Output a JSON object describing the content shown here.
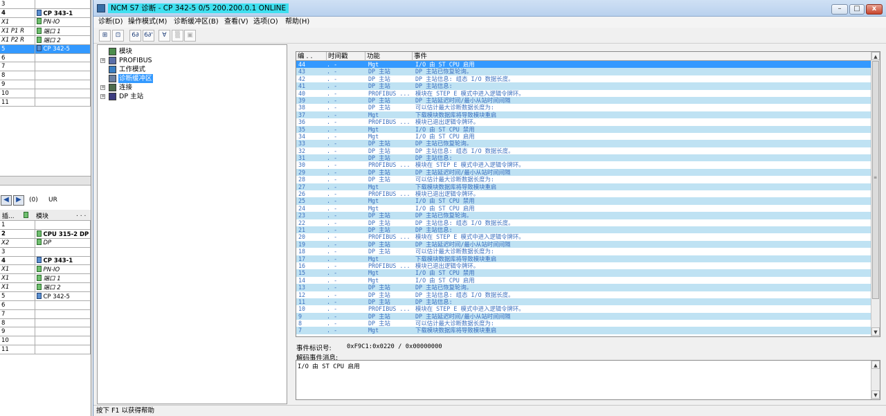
{
  "hwconfig": {
    "rack_top_rows": [
      {
        "slot": "3",
        "module": "",
        "style": "",
        "icon": ""
      },
      {
        "slot": "4",
        "module": "CP 343-1",
        "style": "bold",
        "icon": "cp"
      },
      {
        "slot": "X1",
        "module": "PN-IO",
        "style": "ital",
        "icon": "mod"
      },
      {
        "slot": "X1 P1 R",
        "module": "端口 1",
        "style": "ital",
        "icon": "mod"
      },
      {
        "slot": "X1 P2 R",
        "module": "端口 2",
        "style": "ital",
        "icon": "mod"
      },
      {
        "slot": "5",
        "module": "CP 342-5",
        "style": "sel",
        "icon": "cp"
      },
      {
        "slot": "6",
        "module": "",
        "style": "",
        "icon": ""
      },
      {
        "slot": "7",
        "module": "",
        "style": "",
        "icon": ""
      },
      {
        "slot": "8",
        "module": "",
        "style": "",
        "icon": ""
      },
      {
        "slot": "9",
        "module": "",
        "style": "",
        "icon": ""
      },
      {
        "slot": "10",
        "module": "",
        "style": "",
        "icon": ""
      },
      {
        "slot": "11",
        "module": "",
        "style": "",
        "icon": ""
      }
    ],
    "nav_rack_id": "(0)",
    "nav_rack_name": "UR",
    "slot_header_col1": "插...",
    "slot_header_col2": "模块",
    "slot_header_col3": ". . .",
    "rack_bottom_rows": [
      {
        "slot": "1",
        "module": "",
        "style": "",
        "icon": ""
      },
      {
        "slot": "2",
        "module": "CPU 315-2 DP",
        "style": "bold",
        "icon": "mod"
      },
      {
        "slot": "X2",
        "module": "DP",
        "style": "ital",
        "icon": "mod"
      },
      {
        "slot": "3",
        "module": "",
        "style": "",
        "icon": ""
      },
      {
        "slot": "4",
        "module": "CP 343-1",
        "style": "bold",
        "icon": "cp"
      },
      {
        "slot": "X1",
        "module": "PN-IO",
        "style": "ital",
        "icon": "mod"
      },
      {
        "slot": "X1",
        "module": "端口 1",
        "style": "ital",
        "icon": "mod"
      },
      {
        "slot": "X1",
        "module": "端口 2",
        "style": "ital",
        "icon": "mod"
      },
      {
        "slot": "5",
        "module": "CP 342-5",
        "style": "",
        "icon": "cp"
      },
      {
        "slot": "6",
        "module": "",
        "style": "",
        "icon": ""
      },
      {
        "slot": "7",
        "module": "",
        "style": "",
        "icon": ""
      },
      {
        "slot": "8",
        "module": "",
        "style": "",
        "icon": ""
      },
      {
        "slot": "9",
        "module": "",
        "style": "",
        "icon": ""
      },
      {
        "slot": "10",
        "module": "",
        "style": "",
        "icon": ""
      },
      {
        "slot": "11",
        "module": "",
        "style": "",
        "icon": ""
      }
    ]
  },
  "window": {
    "title": "NCM S7 诊断 - CP 342-5 0/5 200.200.0.1  ONLINE",
    "minimize": "–",
    "maximize": "□",
    "close": "x"
  },
  "menu": [
    {
      "label": "诊断(D)",
      "name": "menu-diagnose"
    },
    {
      "label": "操作模式(M)",
      "name": "menu-operating-mode"
    },
    {
      "label": "诊断缓冲区(B)",
      "name": "menu-diag-buffer"
    },
    {
      "label": "查看(V)",
      "name": "menu-view"
    },
    {
      "label": "选项(O)",
      "name": "menu-options"
    },
    {
      "label": "帮助(H)",
      "name": "menu-help"
    }
  ],
  "toolbar": [
    {
      "glyph": "⊞",
      "name": "station-button",
      "disabled": false
    },
    {
      "glyph": "⊡",
      "name": "module-button",
      "disabled": false
    },
    {
      "glyph": "6∂",
      "name": "online-button",
      "disabled": false
    },
    {
      "glyph": "6∂'",
      "name": "offline-button",
      "disabled": false
    },
    {
      "glyph": "∀",
      "name": "filter-button",
      "disabled": false
    },
    {
      "glyph": "▒",
      "name": "refresh-button",
      "disabled": true
    },
    {
      "glyph": "▣",
      "name": "print-button",
      "disabled": true
    }
  ],
  "tree": [
    {
      "label": "模块",
      "expander": "",
      "icon": "module",
      "selected": false
    },
    {
      "label": "PROFIBUS",
      "expander": "+",
      "icon": "network",
      "selected": false
    },
    {
      "label": "工作模式",
      "expander": "",
      "icon": "mode",
      "selected": false
    },
    {
      "label": "诊断缓冲区",
      "expander": "",
      "icon": "buffer",
      "selected": true
    },
    {
      "label": "连接",
      "expander": "+",
      "icon": "connection",
      "selected": false
    },
    {
      "label": "DP 主站",
      "expander": "+",
      "icon": "dp",
      "selected": false
    }
  ],
  "event_list": {
    "columns": [
      "编 . .",
      "时间戳",
      "功能",
      "事件"
    ],
    "rows": [
      [
        "44",
        ". -",
        "Mgt",
        "I/O 由 ST CPU 启用"
      ],
      [
        "43",
        ". -",
        "DP 主站",
        "DP 主站已恢复轮询。"
      ],
      [
        "42",
        ". -",
        "DP 主站",
        "DP 主站信息: 组态 I/O 数据长度。"
      ],
      [
        "41",
        ". -",
        "DP 主站",
        "DP 主站信息:"
      ],
      [
        "40",
        ". -",
        "PROFIBUS ...",
        "模块在 STEP E 模式中进入逻辑令牌环。"
      ],
      [
        "39",
        ". -",
        "DP 主站",
        "DP 主站延迟时间/最小从站时间间隔"
      ],
      [
        "38",
        ". -",
        "DP 主站",
        "可以估计最大诊断数据长度为:"
      ],
      [
        "37",
        ". -",
        "Mgt",
        "下载模块数据库将导致模块重启"
      ],
      [
        "36",
        ". -",
        "PROFIBUS ...",
        "模块已退出逻辑令牌环。"
      ],
      [
        "35",
        ". -",
        "Mgt",
        "I/O 由 ST CPU 禁用"
      ],
      [
        "34",
        ". -",
        "Mgt",
        "I/O 由 ST CPU 启用"
      ],
      [
        "33",
        ". -",
        "DP 主站",
        "DP 主站已恢复轮询。"
      ],
      [
        "32",
        ". -",
        "DP 主站",
        "DP 主站信息: 组态 I/O 数据长度。"
      ],
      [
        "31",
        ". -",
        "DP 主站",
        "DP 主站信息:"
      ],
      [
        "30",
        ". -",
        "PROFIBUS ...",
        "模块在 STEP E 模式中进入逻辑令牌环。"
      ],
      [
        "29",
        ". -",
        "DP 主站",
        "DP 主站延迟时间/最小从站时间间隔"
      ],
      [
        "28",
        ". -",
        "DP 主站",
        "可以估计最大诊断数据长度为:"
      ],
      [
        "27",
        ". -",
        "Mgt",
        "下载模块数据库将导致模块重启"
      ],
      [
        "26",
        ". -",
        "PROFIBUS ...",
        "模块已退出逻辑令牌环。"
      ],
      [
        "25",
        ". -",
        "Mgt",
        "I/O 由 ST CPU 禁用"
      ],
      [
        "24",
        ". -",
        "Mgt",
        "I/O 由 ST CPU 启用"
      ],
      [
        "23",
        ". -",
        "DP 主站",
        "DP 主站已恢复轮询。"
      ],
      [
        "22",
        ". -",
        "DP 主站",
        "DP 主站信息: 组态 I/O 数据长度。"
      ],
      [
        "21",
        ". -",
        "DP 主站",
        "DP 主站信息:"
      ],
      [
        "20",
        ". -",
        "PROFIBUS ...",
        "模块在 STEP E 模式中进入逻辑令牌环。"
      ],
      [
        "19",
        ". -",
        "DP 主站",
        "DP 主站延迟时间/最小从站时间间隔"
      ],
      [
        "18",
        ". -",
        "DP 主站",
        "可以估计最大诊断数据长度为:"
      ],
      [
        "17",
        ". -",
        "Mgt",
        "下载模块数据库将导致模块重启"
      ],
      [
        "16",
        ". -",
        "PROFIBUS ...",
        "模块已退出逻辑令牌环。"
      ],
      [
        "15",
        ". -",
        "Mgt",
        "I/O 由 ST CPU 禁用"
      ],
      [
        "14",
        ". -",
        "Mgt",
        "I/O 由 ST CPU 启用"
      ],
      [
        "13",
        ". -",
        "DP 主站",
        "DP 主站已恢复轮询。"
      ],
      [
        "12",
        ". -",
        "DP 主站",
        "DP 主站信息: 组态 I/O 数据长度。"
      ],
      [
        "11",
        ". -",
        "DP 主站",
        "DP 主站信息:"
      ],
      [
        "10",
        ". -",
        "PROFIBUS ...",
        "模块在 STEP E 模式中进入逻辑令牌环。"
      ],
      [
        "9",
        ". -",
        "DP 主站",
        "DP 主站延迟时间/最小从站时间间隔"
      ],
      [
        "8",
        ". -",
        "DP 主站",
        "可以估计最大诊断数据长度为:"
      ],
      [
        "7",
        ". -",
        "Mgt",
        "下载模块数据库将导致模块重启"
      ]
    ]
  },
  "detail": {
    "event_id_label": "事件标识号:",
    "event_id_value": "0xF9C1:0x0220 / 0x00000000",
    "decoded_label": "解码事件消息:",
    "decoded_text": "I/O 由 ST CPU 启用"
  },
  "statusbar": {
    "text": "按下 F1 以获得帮助"
  }
}
